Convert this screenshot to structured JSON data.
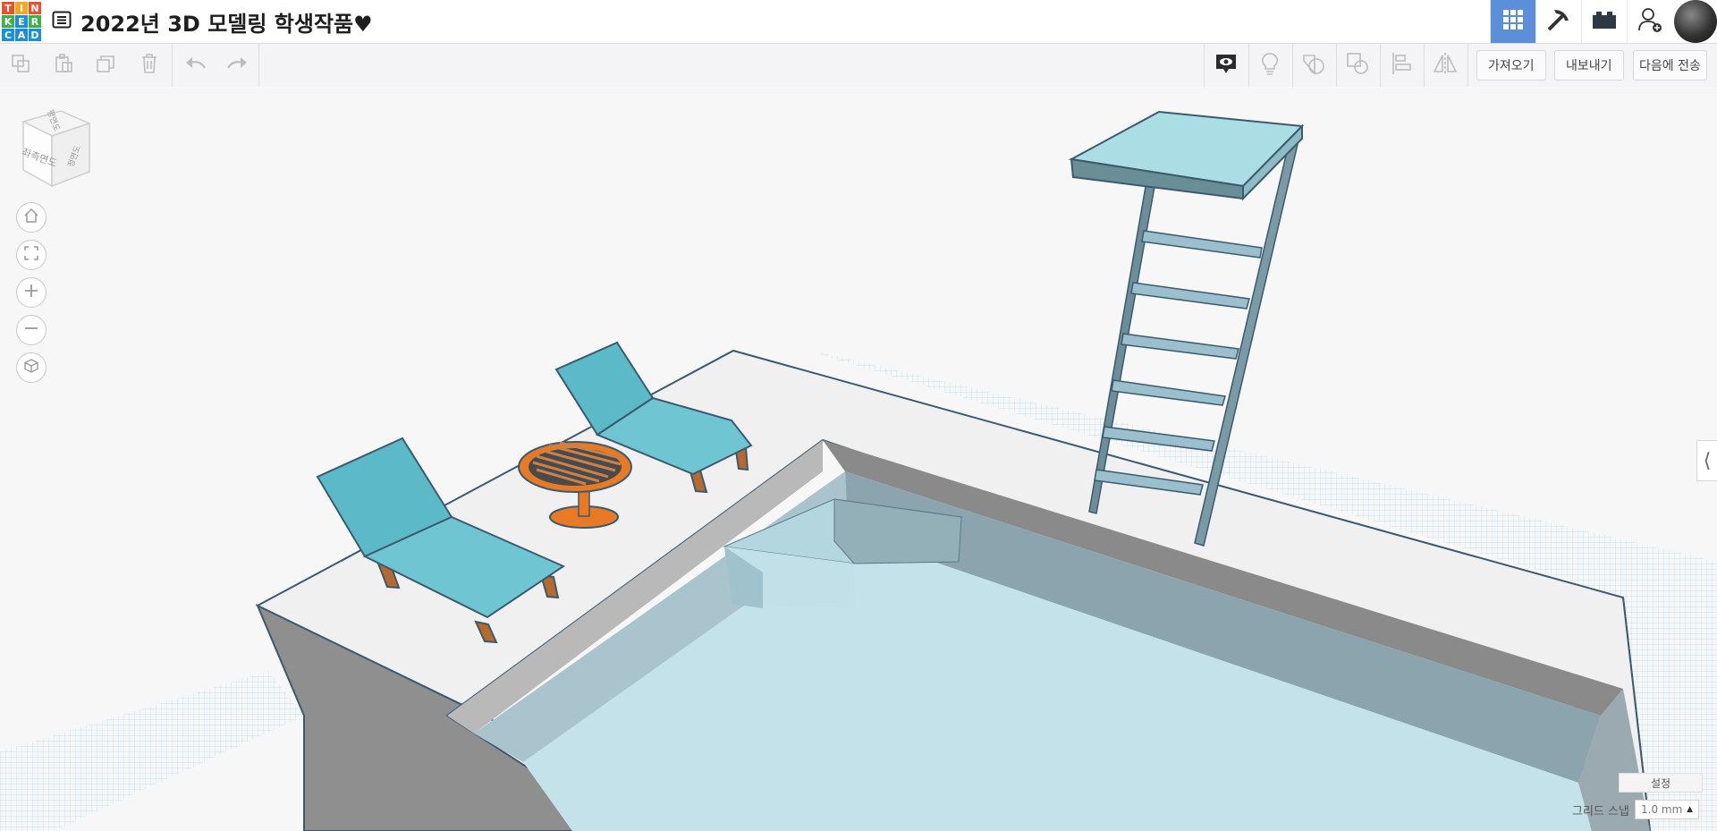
{
  "logo": {
    "letters": [
      "T",
      "I",
      "N",
      "K",
      "E",
      "R",
      "C",
      "A",
      "D"
    ],
    "colors": [
      "#e8502f",
      "#f6a623",
      "#e8502f",
      "#3eb14b",
      "#1c8fd6",
      "#3eb14b",
      "#1c8fd6",
      "#1c8fd6",
      "#1c8fd6"
    ]
  },
  "header": {
    "title": "2022년 3D 모델링 학생작품♥",
    "menu_icon": "list-icon",
    "accent": "#5b8fd9"
  },
  "top_right": {
    "buttons": [
      "grid-view-icon",
      "pickaxe-icon",
      "brick-icon",
      "add-user-icon"
    ],
    "avatar": "avatar"
  },
  "toolbar": {
    "left_tools": [
      "copy-icon",
      "paste-icon",
      "duplicate-icon",
      "delete-icon",
      "undo-icon",
      "redo-icon"
    ],
    "right_tools": [
      "notes-icon",
      "lightbulb-icon",
      "shape-icon",
      "group-icon",
      "align-icon",
      "mirror-icon"
    ],
    "import_label": "가져오기",
    "export_label": "내보내기",
    "send_label": "다음에 전송"
  },
  "viewcube": {
    "top_label": "평면도",
    "front_label": "좌측면도",
    "side_label": "정면도"
  },
  "nav": [
    "home-icon",
    "fit-icon",
    "zoom-in-icon",
    "zoom-out-icon",
    "perspective-icon"
  ],
  "bottom": {
    "settings_label": "설정",
    "snap_label": "그리드 스냅",
    "snap_value": "1.0 mm"
  },
  "colors": {
    "chair": "#5cb9c8",
    "table": "#e87a25",
    "pool_water": "#bfe0e8",
    "deck": "#f0f0f0",
    "grid": "#8fcfe6"
  }
}
